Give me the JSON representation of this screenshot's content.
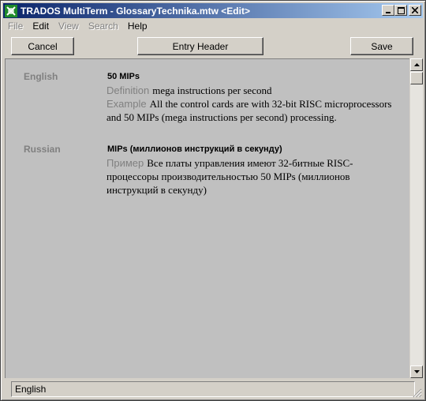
{
  "window": {
    "title": "TRADOS MultiTerm - GlossaryTechnika.mtw <Edit>"
  },
  "menu": [
    {
      "label": "File",
      "enabled": false
    },
    {
      "label": "Edit",
      "enabled": true
    },
    {
      "label": "View",
      "enabled": false
    },
    {
      "label": "Search",
      "enabled": false
    },
    {
      "label": "Help",
      "enabled": true
    }
  ],
  "toolbar": {
    "cancel_label": "Cancel",
    "entry_header_label": "Entry Header",
    "save_label": "Save"
  },
  "entries": [
    {
      "language": "English",
      "term": "50 MIPs",
      "definition_label": "Definition",
      "definition": "mega instructions per second",
      "example_label": "Example",
      "example": "All the control cards are with 32-bit RISC microprocessors and 50 MIPs (mega instructions per second) processing."
    },
    {
      "language": "Russian",
      "term": "MIPs (миллионов инструкций в секунду)",
      "example_label": "Пример",
      "example": "Все платы управления имеют 32-битные RISC-процессоры производительностью 50 MIPs (миллионов инструкций в секунду)"
    }
  ],
  "status": {
    "text": "English"
  },
  "icons": {
    "app": "multiterm-app-icon",
    "minimize": "minimize-icon",
    "maximize": "maximize-icon",
    "close": "close-icon",
    "scroll_up": "arrow-up-icon",
    "scroll_down": "arrow-down-icon",
    "grip": "resize-grip-icon"
  },
  "colors": {
    "titlebar_start": "#0a246a",
    "titlebar_end": "#a6caf0",
    "content_bg": "#c0c0c0",
    "label_gray": "#808080",
    "app_icon_green": "#1f8a2a"
  }
}
